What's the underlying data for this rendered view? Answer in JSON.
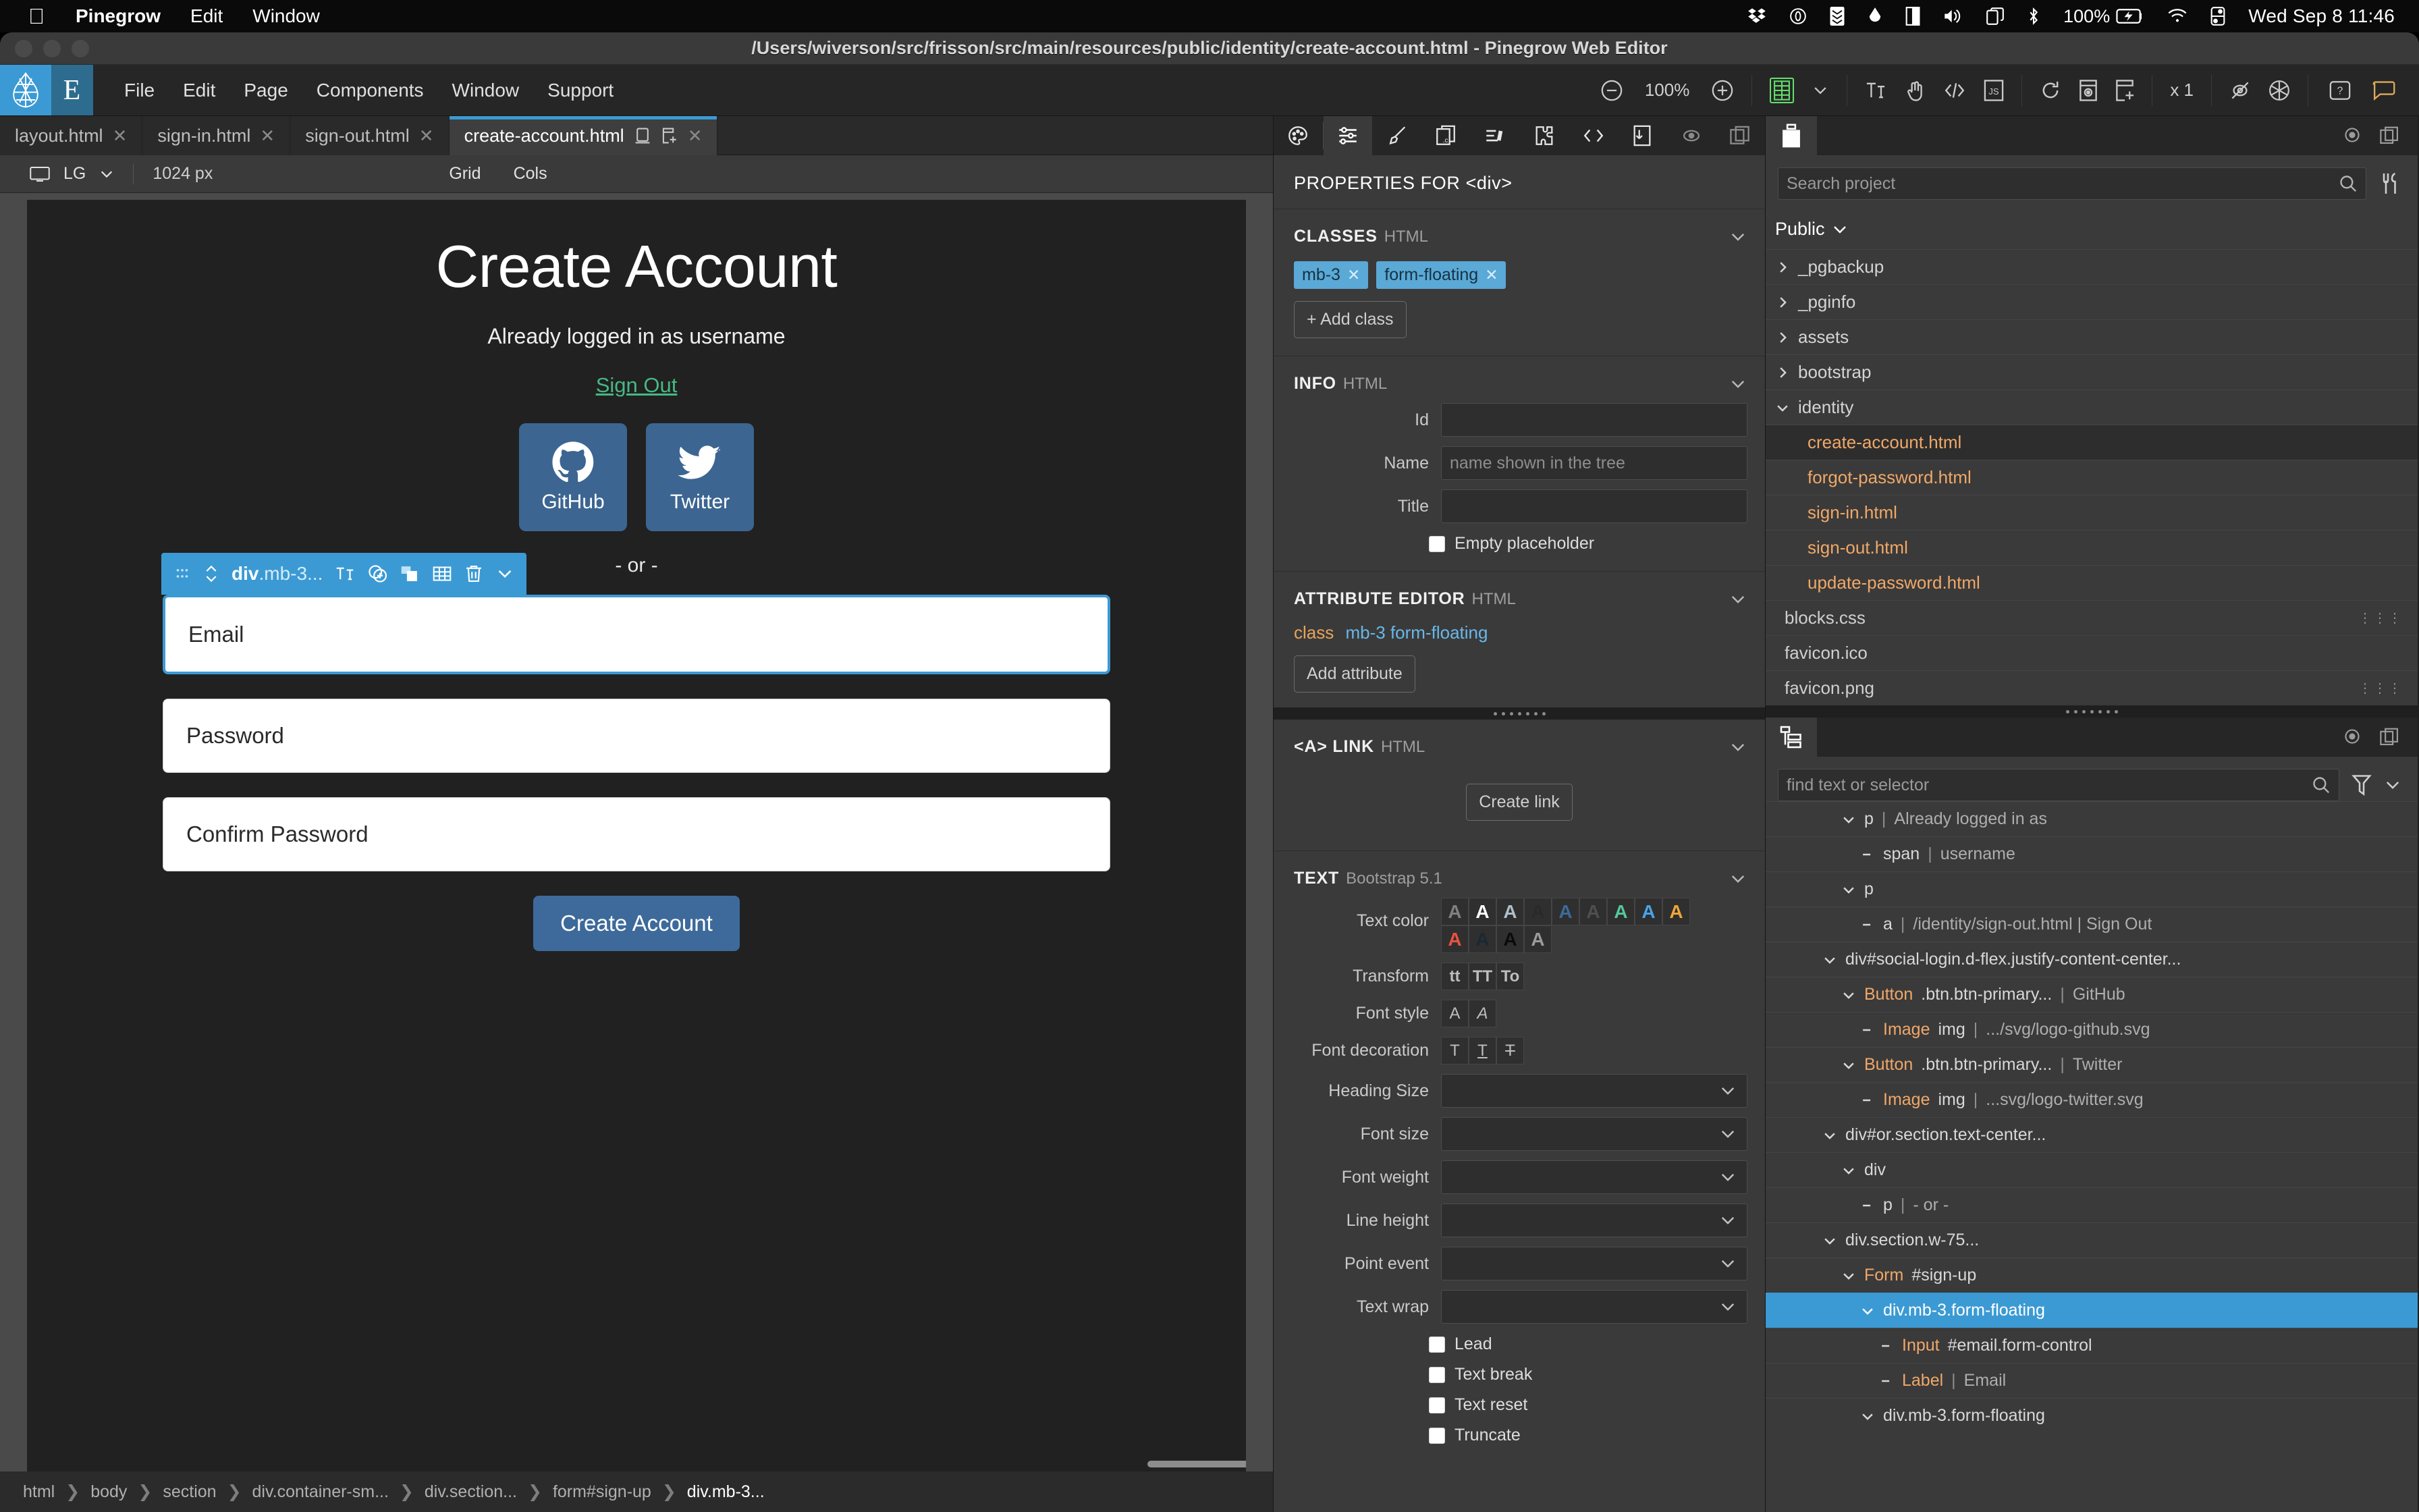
{
  "macbar": {
    "apple_icon": "apple-icon",
    "items": [
      {
        "label": "Pinegrow",
        "bold": true
      },
      {
        "label": "Edit",
        "bold": false
      },
      {
        "label": "Window",
        "bold": false
      }
    ],
    "battery_percent": "100%",
    "clock": "Wed Sep 8  11:46",
    "status_icons": [
      "dropbox-icon",
      "zero-icon",
      "stack-icon",
      "drop-icon",
      "split-icon",
      "volume-icon",
      "screen-mirror-icon",
      "bluetooth-icon",
      "battery-icon",
      "wifi-icon",
      "control-center-icon"
    ]
  },
  "window": {
    "title": "/Users/wiverson/src/frisson/src/main/resources/public/identity/create-account.html - Pinegrow Web Editor"
  },
  "toolbar": {
    "logo_letter": "E",
    "menus": [
      "File",
      "Edit",
      "Page",
      "Components",
      "Window",
      "Support"
    ],
    "zoom_level": "100%",
    "multiplier": "x 1",
    "icons": [
      "zoom-out-icon",
      "zoom-in-icon",
      "grid-overlay-icon",
      "chevron-down-icon",
      "text-edit-icon",
      "hand-select-icon",
      "code-icon",
      "js-icon",
      "reload-icon",
      "preview-icon",
      "open-in-new-icon",
      "hidden-eye-icon",
      "snowflake-icon",
      "help-icon",
      "chat-icon"
    ]
  },
  "tabs": [
    {
      "label": "layout.html",
      "active": false
    },
    {
      "label": "sign-in.html",
      "active": false
    },
    {
      "label": "sign-out.html",
      "active": false
    },
    {
      "label": "create-account.html",
      "active": true
    }
  ],
  "device_bar": {
    "device": "LG",
    "width": "1024 px",
    "grid_label": "Grid",
    "cols_label": "Cols"
  },
  "page": {
    "title": "Create Account",
    "subtitle": "Already logged in as username",
    "sign_out_link": "Sign Out",
    "social_buttons": [
      {
        "label": "GitHub",
        "icon": "github-icon"
      },
      {
        "label": "Twitter",
        "icon": "twitter-icon"
      }
    ],
    "or_text": "- or -",
    "fields": [
      {
        "label": "Email",
        "selected": true
      },
      {
        "label": "Password",
        "selected": false
      },
      {
        "label": "Confirm Password",
        "selected": false
      }
    ],
    "submit_label": "Create Account",
    "selection_toolbar": {
      "name_bold": "div",
      "name_rest": ".mb-3...",
      "icons": [
        "drag-handle-icon",
        "move-updown-icon",
        "text-edit-icon",
        "add-element-icon",
        "duplicate-icon",
        "grid-icon",
        "trash-icon",
        "chevron-down-icon"
      ]
    }
  },
  "breadcrumb": [
    "html",
    "body",
    "section",
    "div.container-sm...",
    "div.section...",
    "form#sign-up",
    "div.mb-3..."
  ],
  "properties": {
    "panel_icons": [
      "palette-icon",
      "sliders-icon",
      "brush-icon",
      "css-file-icon",
      "list-icon",
      "puzzle-icon",
      "code-icon",
      "export-icon",
      "eye-icon",
      "copy-icon"
    ],
    "header": "PROPERTIES FOR",
    "header_tag": "<div>",
    "sections": {
      "classes": {
        "title": "CLASSES",
        "subtitle": "HTML",
        "chips": [
          "mb-3",
          "form-floating"
        ],
        "add_label": "+ Add class"
      },
      "info": {
        "title": "INFO",
        "subtitle": "HTML",
        "fields": [
          {
            "label": "Id",
            "value": "",
            "placeholder": ""
          },
          {
            "label": "Name",
            "value": "",
            "placeholder": "name shown in the tree"
          },
          {
            "label": "Title",
            "value": "",
            "placeholder": ""
          }
        ],
        "checkbox_label": "Empty placeholder",
        "checkbox_checked": false
      },
      "attribute_editor": {
        "title": "ATTRIBUTE EDITOR",
        "subtitle": "HTML",
        "attr_key": "class",
        "attr_value": "mb-3 form-floating",
        "add_label": "Add attribute"
      },
      "link": {
        "title": "<A> LINK",
        "subtitle": "HTML",
        "button_label": "Create link"
      },
      "text": {
        "title": "TEXT",
        "subtitle": "Bootstrap 5.1",
        "text_color_label": "Text color",
        "text_colors": [
          "#808080",
          "#ffffff",
          "#b0bec8",
          "#2a2a2a",
          "#3d6a9a",
          "#4f4f4f",
          "#55c79a",
          "#4aa3e8",
          "#eda73c",
          "#e8533f",
          "#1c2833",
          "#0b0b0b",
          "#9b9b9b"
        ],
        "transform_label": "Transform",
        "transform_options": [
          "tt",
          "TT",
          "To"
        ],
        "font_style_label": "Font style",
        "font_style_options": [
          "A",
          "A"
        ],
        "font_decoration_label": "Font decoration",
        "font_decoration_options": [
          "T",
          "T",
          "T"
        ],
        "selects": [
          {
            "label": "Heading Size",
            "value": ""
          },
          {
            "label": "Font size",
            "value": ""
          },
          {
            "label": "Font weight",
            "value": ""
          },
          {
            "label": "Line height",
            "value": ""
          },
          {
            "label": "Point event",
            "value": ""
          },
          {
            "label": "Text wrap",
            "value": ""
          }
        ],
        "checkboxes": [
          {
            "label": "Lead",
            "checked": false
          },
          {
            "label": "Text break",
            "checked": false
          },
          {
            "label": "Text reset",
            "checked": false
          },
          {
            "label": "Truncate",
            "checked": false
          }
        ]
      }
    }
  },
  "project": {
    "tab_icon": "project-icon",
    "search_placeholder": "Search project",
    "tools_icon": "tools-icon",
    "root_label": "Public",
    "items": [
      {
        "label": "_pgbackup",
        "type": "folder",
        "expanded": false,
        "selected": false
      },
      {
        "label": "_pginfo",
        "type": "folder",
        "expanded": false,
        "selected": false
      },
      {
        "label": "assets",
        "type": "folder",
        "expanded": false,
        "selected": false
      },
      {
        "label": "bootstrap",
        "type": "folder",
        "expanded": false,
        "selected": false
      },
      {
        "label": "identity",
        "type": "folder",
        "expanded": true,
        "selected": false
      },
      {
        "label": "create-account.html",
        "type": "file",
        "selected": true
      },
      {
        "label": "forgot-password.html",
        "type": "file",
        "selected": false
      },
      {
        "label": "sign-in.html",
        "type": "file",
        "selected": false
      },
      {
        "label": "sign-out.html",
        "type": "file",
        "selected": false
      },
      {
        "label": "update-password.html",
        "type": "file",
        "selected": false
      },
      {
        "label": "blocks.css",
        "type": "plain",
        "dots": true
      },
      {
        "label": "favicon.ico",
        "type": "plain",
        "dots": false
      },
      {
        "label": "favicon.png",
        "type": "plain",
        "dots": true
      }
    ]
  },
  "dom_tree": {
    "tab_icon": "tree-icon",
    "search_placeholder": "find text or selector",
    "nodes": [
      {
        "indent": 3,
        "caret": "down",
        "tag": "p",
        "bar": "|",
        "text": "Already logged in as",
        "orange": false,
        "selected": false
      },
      {
        "indent": 4,
        "caret": "dash",
        "tag": "span",
        "bar": "|",
        "text": "username",
        "orange": false,
        "selected": false
      },
      {
        "indent": 3,
        "caret": "down",
        "tag": "p",
        "bar": "",
        "text": "",
        "orange": false,
        "selected": false
      },
      {
        "indent": 4,
        "caret": "dash",
        "tag": "a",
        "bar": "|",
        "text": "/identity/sign-out.html | Sign Out",
        "orange": false,
        "selected": false
      },
      {
        "indent": 2,
        "caret": "down",
        "tag": "div#social-login.d-flex.justify-content-center...",
        "bar": "",
        "text": "",
        "orange": false,
        "selected": false
      },
      {
        "indent": 3,
        "caret": "down",
        "tag": "Button",
        "extra": ".btn.btn-primary...",
        "bar": "|",
        "text": "GitHub",
        "orange": true,
        "selected": false
      },
      {
        "indent": 4,
        "caret": "dash",
        "tag": "Image",
        "extra": "img",
        "bar": "|",
        "text": ".../svg/logo-github.svg",
        "orange": true,
        "selected": false
      },
      {
        "indent": 3,
        "caret": "down",
        "tag": "Button",
        "extra": ".btn.btn-primary...",
        "bar": "|",
        "text": "Twitter",
        "orange": true,
        "selected": false
      },
      {
        "indent": 4,
        "caret": "dash",
        "tag": "Image",
        "extra": "img",
        "bar": "|",
        "text": "...svg/logo-twitter.svg",
        "orange": true,
        "selected": false
      },
      {
        "indent": 2,
        "caret": "down",
        "tag": "div#or.section.text-center...",
        "bar": "",
        "text": "",
        "orange": false,
        "selected": false
      },
      {
        "indent": 3,
        "caret": "down",
        "tag": "div",
        "bar": "",
        "text": "",
        "orange": false,
        "selected": false
      },
      {
        "indent": 4,
        "caret": "dash",
        "tag": "p",
        "bar": "|",
        "text": "- or -",
        "orange": false,
        "selected": false
      },
      {
        "indent": 2,
        "caret": "down",
        "tag": "div.section.w-75...",
        "bar": "",
        "text": "",
        "orange": false,
        "selected": false
      },
      {
        "indent": 3,
        "caret": "down",
        "tag": "Form",
        "extra": "#sign-up",
        "bar": "",
        "text": "",
        "orange": true,
        "selected": false
      },
      {
        "indent": 4,
        "caret": "down",
        "tag": "div.mb-3.form-floating",
        "bar": "",
        "text": "",
        "orange": false,
        "selected": true
      },
      {
        "indent": 5,
        "caret": "dash",
        "tag": "Input",
        "extra": "#email.form-control",
        "bar": "",
        "text": "",
        "orange": true,
        "selected": false
      },
      {
        "indent": 5,
        "caret": "dash",
        "tag": "Label",
        "bar": "|",
        "text": "Email",
        "orange": true,
        "selected": false
      },
      {
        "indent": 4,
        "caret": "down",
        "tag": "div.mb-3.form-floating",
        "bar": "",
        "text": "",
        "orange": false,
        "selected": false
      }
    ]
  }
}
